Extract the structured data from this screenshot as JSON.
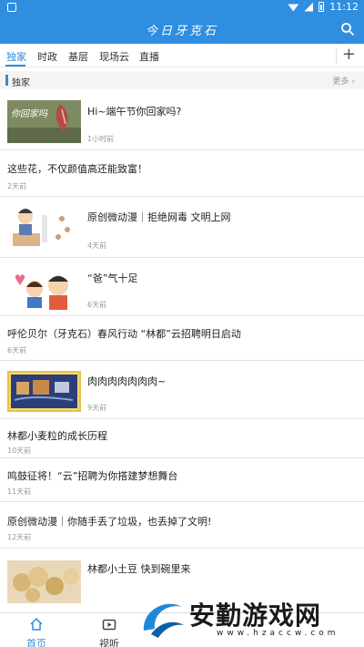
{
  "status_bar": {
    "time": "11:12"
  },
  "header": {
    "title": "今日牙克石"
  },
  "tabs": [
    {
      "label": "独家"
    },
    {
      "label": "时政"
    },
    {
      "label": "基层"
    },
    {
      "label": "现场云"
    },
    {
      "label": "直播"
    }
  ],
  "section": {
    "title": "独家",
    "more_label": "更多"
  },
  "feed": [
    {
      "title": "Hi~端午节你回家吗?",
      "time": "1小时前",
      "thumb_text": "你回家吗"
    },
    {
      "title": "这些花，不仅颜值高还能致富！",
      "time": "2天前"
    },
    {
      "title": "原创微动漫｜拒绝网毒 文明上网",
      "time": "4天前"
    },
    {
      "title": "“爸”气十足",
      "time": "6天前"
    },
    {
      "title": "呼伦贝尔（牙克石）春风行动 “林都”云招聘明日启动",
      "time": "6天前"
    },
    {
      "title": "肉肉肉肉肉肉肉~",
      "time": "9天前"
    },
    {
      "title": "林都小麦粒的成长历程",
      "time": "10天前"
    },
    {
      "title": "鸣鼓征将！“云”招聘为你搭建梦想舞台",
      "time": "11天前"
    },
    {
      "title": "原创微动漫｜你随手丢了垃圾，也丢掉了文明!",
      "time": "12天前"
    },
    {
      "title": "林都小土豆 快到碗里来",
      "time": ""
    }
  ],
  "bottom_nav": {
    "home_label": "首页",
    "listen_label": "视听"
  },
  "watermark": {
    "title": "安勤游戏网",
    "url": "www.hzaccw.com"
  },
  "colors": {
    "brand": "#2f8ee0"
  }
}
